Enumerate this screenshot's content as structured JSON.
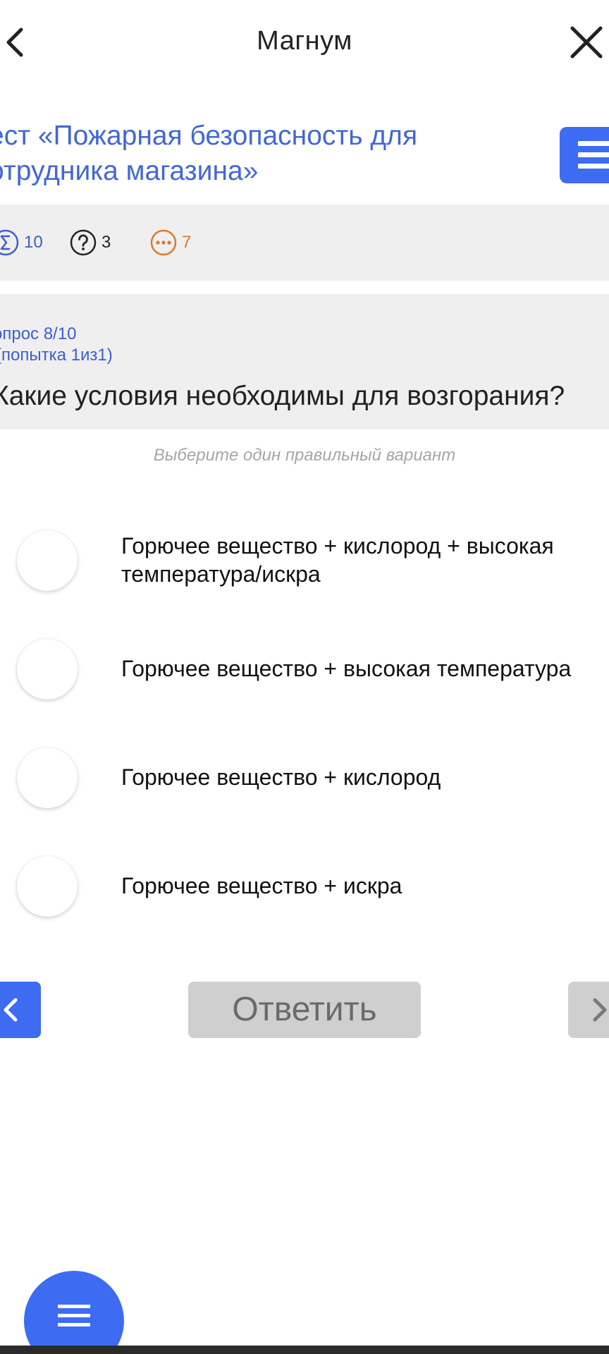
{
  "appbar": {
    "title": "Магнум",
    "back_icon": "chevron-left-icon",
    "close_icon": "close-icon"
  },
  "test": {
    "title_line1": "ест «Пожарная безопасность для",
    "title_line2": "отрудника магазина»",
    "menu_icon": "menu-icon"
  },
  "stats": {
    "total": "10",
    "unanswered": "3",
    "remaining": "7"
  },
  "question": {
    "number": "опрос 8/10",
    "attempt": "(попытка 1из1)",
    "text": "Какие условия необходимы для возгорания?",
    "hint": "Выберите один правильный вариант"
  },
  "options": [
    {
      "line1": "Горючее вещество + кислород + высокая",
      "line2": "температура/искра"
    },
    {
      "line1": "Горючее вещество + высокая температура",
      "line2": ""
    },
    {
      "line1": "Горючее вещество + кислород",
      "line2": ""
    },
    {
      "line1": "Горючее вещество + искра",
      "line2": ""
    }
  ],
  "nav": {
    "answer_label": "Ответить",
    "prev_icon": "chevron-left-icon",
    "next_icon": "chevron-right-icon"
  },
  "fab": {
    "icon": "menu-icon"
  },
  "colors": {
    "accent": "#3d6cf2",
    "link": "#4267d6",
    "warning": "#d97a2c",
    "panel": "#efefef",
    "disabled": "#cfcfcf"
  }
}
